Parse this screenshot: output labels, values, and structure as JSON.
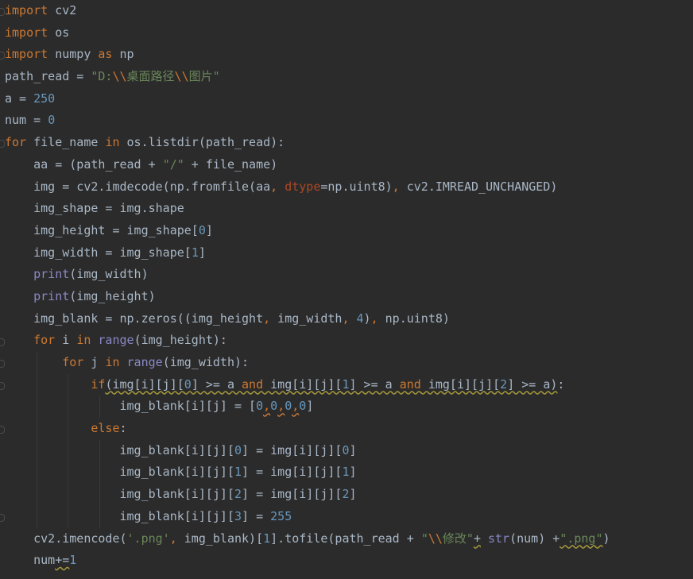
{
  "editor": {
    "language": "python",
    "background": "#2b2b2b",
    "colors": {
      "keyword": "#cc7832",
      "number": "#6897bb",
      "string": "#6a8759",
      "builtin": "#8888c6",
      "param": "#aa4926",
      "default": "#a9b7c6"
    },
    "lines": [
      {
        "indent": 0,
        "fold": true,
        "tokens": [
          {
            "t": "import",
            "c": "kw"
          },
          {
            "t": " cv2"
          }
        ]
      },
      {
        "indent": 0,
        "fold": false,
        "tokens": [
          {
            "t": "import",
            "c": "kw"
          },
          {
            "t": " os"
          }
        ]
      },
      {
        "indent": 0,
        "fold": true,
        "tokens": [
          {
            "t": "import",
            "c": "kw"
          },
          {
            "t": " numpy "
          },
          {
            "t": "as",
            "c": "kw"
          },
          {
            "t": " np"
          }
        ]
      },
      {
        "indent": 0,
        "fold": false,
        "tokens": [
          {
            "t": "path_read = "
          },
          {
            "t": "\"D:",
            "c": "str"
          },
          {
            "t": "\\\\",
            "c": "esc"
          },
          {
            "t": "桌面路径",
            "c": "str"
          },
          {
            "t": "\\\\",
            "c": "esc"
          },
          {
            "t": "图片\"",
            "c": "str"
          }
        ]
      },
      {
        "indent": 0,
        "fold": false,
        "tokens": [
          {
            "t": "a = "
          },
          {
            "t": "250",
            "c": "num"
          }
        ]
      },
      {
        "indent": 0,
        "fold": false,
        "tokens": [
          {
            "t": "num = "
          },
          {
            "t": "0",
            "c": "num"
          }
        ]
      },
      {
        "indent": 0,
        "fold": true,
        "tokens": [
          {
            "t": "for",
            "c": "kw"
          },
          {
            "t": " file_name "
          },
          {
            "t": "in",
            "c": "kw"
          },
          {
            "t": " os.listdir(path_read):"
          }
        ]
      },
      {
        "indent": 1,
        "fold": false,
        "tokens": [
          {
            "t": "aa = (path_read + "
          },
          {
            "t": "\"/\"",
            "c": "str"
          },
          {
            "t": " + file_name)"
          }
        ]
      },
      {
        "indent": 1,
        "fold": false,
        "tokens": [
          {
            "t": "img = cv2.imdecode(np.fromfile(aa"
          },
          {
            "t": ", ",
            "c": "kw"
          },
          {
            "t": "dtype",
            "c": "param"
          },
          {
            "t": "=np.uint8)"
          },
          {
            "t": ", ",
            "c": "kw"
          },
          {
            "t": "cv2.IMREAD_UNCHANGED)"
          }
        ]
      },
      {
        "indent": 1,
        "fold": false,
        "tokens": [
          {
            "t": "img_shape = img.shape"
          }
        ]
      },
      {
        "indent": 1,
        "fold": false,
        "tokens": [
          {
            "t": "img_height = img_shape["
          },
          {
            "t": "0",
            "c": "num"
          },
          {
            "t": "]"
          }
        ]
      },
      {
        "indent": 1,
        "fold": false,
        "tokens": [
          {
            "t": "img_width = img_shape["
          },
          {
            "t": "1",
            "c": "num"
          },
          {
            "t": "]"
          }
        ]
      },
      {
        "indent": 1,
        "fold": false,
        "tokens": [
          {
            "t": "print",
            "c": "bi"
          },
          {
            "t": "(img_width)"
          }
        ]
      },
      {
        "indent": 1,
        "fold": false,
        "tokens": [
          {
            "t": "print",
            "c": "bi"
          },
          {
            "t": "(img_height)"
          }
        ]
      },
      {
        "indent": 1,
        "fold": false,
        "tokens": [
          {
            "t": "img_blank = np.zeros((img_height"
          },
          {
            "t": ", ",
            "c": "kw"
          },
          {
            "t": "img_width"
          },
          {
            "t": ", ",
            "c": "kw"
          },
          {
            "t": "4",
            "c": "num"
          },
          {
            "t": ")"
          },
          {
            "t": ", ",
            "c": "kw"
          },
          {
            "t": "np.uint8)"
          }
        ]
      },
      {
        "indent": 1,
        "fold": true,
        "tokens": [
          {
            "t": "for",
            "c": "kw"
          },
          {
            "t": " i "
          },
          {
            "t": "in",
            "c": "kw"
          },
          {
            "t": " "
          },
          {
            "t": "range",
            "c": "bi"
          },
          {
            "t": "(img_height):"
          }
        ]
      },
      {
        "indent": 2,
        "fold": true,
        "tokens": [
          {
            "t": "for",
            "c": "kw"
          },
          {
            "t": " j "
          },
          {
            "t": "in",
            "c": "kw"
          },
          {
            "t": " "
          },
          {
            "t": "range",
            "c": "bi"
          },
          {
            "t": "(img_width):"
          }
        ]
      },
      {
        "indent": 3,
        "fold": true,
        "tokens": [
          {
            "t": "if",
            "c": "kw"
          },
          {
            "t": "(img[i][j][",
            "c": "sq"
          },
          {
            "t": "0",
            "c": "num sq"
          },
          {
            "t": "] >= a ",
            "c": "sq"
          },
          {
            "t": "and",
            "c": "kw sq"
          },
          {
            "t": " img[i][j][",
            "c": "sq"
          },
          {
            "t": "1",
            "c": "num sq"
          },
          {
            "t": "] >= a ",
            "c": "sq"
          },
          {
            "t": "and",
            "c": "kw sq"
          },
          {
            "t": " img[i][j][",
            "c": "sq"
          },
          {
            "t": "2",
            "c": "num sq"
          },
          {
            "t": "] >= a)",
            "c": "sq"
          },
          {
            "t": ":"
          }
        ]
      },
      {
        "indent": 4,
        "fold": false,
        "tokens": [
          {
            "t": "img_blank[i][j] = ["
          },
          {
            "t": "0",
            "c": "num"
          },
          {
            "t": ",",
            "c": "kw sqo"
          },
          {
            "t": "0",
            "c": "num"
          },
          {
            "t": ",",
            "c": "kw sqo"
          },
          {
            "t": "0",
            "c": "num"
          },
          {
            "t": ",",
            "c": "kw sqo"
          },
          {
            "t": "0",
            "c": "num"
          },
          {
            "t": "]"
          }
        ]
      },
      {
        "indent": 3,
        "fold": true,
        "tokens": [
          {
            "t": "else",
            "c": "kw"
          },
          {
            "t": ":"
          }
        ]
      },
      {
        "indent": 4,
        "fold": false,
        "tokens": [
          {
            "t": "img_blank[i][j]["
          },
          {
            "t": "0",
            "c": "num"
          },
          {
            "t": "] = img[i][j]["
          },
          {
            "t": "0",
            "c": "num"
          },
          {
            "t": "]"
          }
        ]
      },
      {
        "indent": 4,
        "fold": false,
        "tokens": [
          {
            "t": "img_blank[i][j]["
          },
          {
            "t": "1",
            "c": "num"
          },
          {
            "t": "] = img[i][j]["
          },
          {
            "t": "1",
            "c": "num"
          },
          {
            "t": "]"
          }
        ]
      },
      {
        "indent": 4,
        "fold": false,
        "tokens": [
          {
            "t": "img_blank[i][j]["
          },
          {
            "t": "2",
            "c": "num"
          },
          {
            "t": "] = img[i][j]["
          },
          {
            "t": "2",
            "c": "num"
          },
          {
            "t": "]"
          }
        ]
      },
      {
        "indent": 4,
        "fold": true,
        "tokens": [
          {
            "t": "img_blank[i][j]["
          },
          {
            "t": "3",
            "c": "num"
          },
          {
            "t": "] = "
          },
          {
            "t": "255",
            "c": "num"
          }
        ]
      },
      {
        "indent": 1,
        "fold": false,
        "tokens": [
          {
            "t": "cv2.imencode("
          },
          {
            "t": "'.png'",
            "c": "str"
          },
          {
            "t": ", ",
            "c": "kw"
          },
          {
            "t": "img_blank)["
          },
          {
            "t": "1",
            "c": "num"
          },
          {
            "t": "].tofile(path_read + "
          },
          {
            "t": "\"",
            "c": "str"
          },
          {
            "t": "\\\\",
            "c": "esc"
          },
          {
            "t": "修改\"",
            "c": "str"
          },
          {
            "t": "+",
            "c": "sq"
          },
          {
            "t": " "
          },
          {
            "t": "str",
            "c": "bi"
          },
          {
            "t": "(num) +"
          },
          {
            "t": "\".png\"",
            "c": "str sq"
          },
          {
            "t": ")"
          }
        ]
      },
      {
        "indent": 1,
        "fold": false,
        "tokens": [
          {
            "t": "num"
          },
          {
            "t": "+=",
            "c": "sq"
          },
          {
            "t": "1",
            "c": "num"
          }
        ]
      }
    ]
  }
}
